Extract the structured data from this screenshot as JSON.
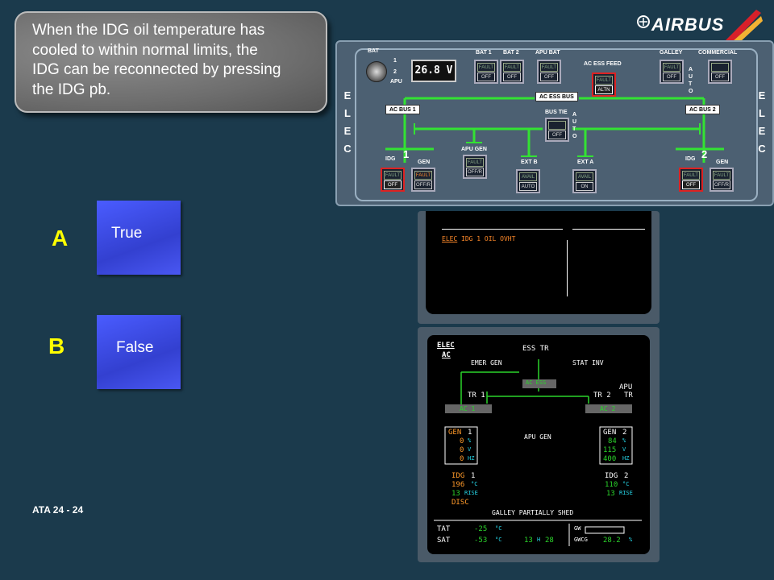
{
  "question": {
    "lines": [
      "When the IDG oil temperature has",
      "cooled to within normal limits, the",
      "IDG can be reconnected by pressing",
      "the IDG pb."
    ]
  },
  "logo": {
    "text": "AIRBUS"
  },
  "answers": [
    {
      "letter": "A",
      "label": "True"
    },
    {
      "letter": "B",
      "label": "False"
    }
  ],
  "footer": {
    "ata": "ATA 24 - 24"
  },
  "overhead": {
    "side_label": [
      "E",
      "L",
      "E",
      "C"
    ],
    "bat_label": "BAT",
    "bat_pos": [
      "1",
      "2",
      "APU"
    ],
    "bat_display": "26.8 V",
    "pbs": {
      "bat1": {
        "title": "BAT 1",
        "f": "FAULT",
        "o": "OFF"
      },
      "bat2": {
        "title": "BAT 2",
        "f": "FAULT",
        "o": "OFF"
      },
      "apubat": {
        "title": "APU BAT",
        "f": "FAULT",
        "o": "OFF"
      },
      "acess": {
        "title": "AC ESS FEED",
        "f": "FAULT",
        "o": "ALTN"
      },
      "galley": {
        "title": "GALLEY",
        "f": "FAULT",
        "o": "OFF"
      },
      "commercial": {
        "title": "COMMERCIAL",
        "f": "",
        "o": "OFF"
      },
      "bustie": {
        "title": "BUS TIE",
        "f": "",
        "o": "OFF"
      },
      "apugen": {
        "title": "APU GEN",
        "f": "FAULT",
        "o": "OFF/R"
      },
      "extb": {
        "title": "EXT B",
        "f": "AVAIL",
        "o": "AUTO"
      },
      "exta": {
        "title": "EXT A",
        "f": "AVAIL",
        "o": "ON"
      },
      "idg1": {
        "title": "IDG",
        "f": "FAULT",
        "o": "OFF"
      },
      "gen1": {
        "title": "GEN",
        "f": "FAULT",
        "o": "OFF/R"
      },
      "idg2": {
        "title": "IDG",
        "f": "FAULT",
        "o": "OFF"
      },
      "gen2": {
        "title": "GEN",
        "f": "FAULT",
        "o": "OFF/R"
      }
    },
    "auto": "AUTO",
    "buses": {
      "acess": "AC ESS BUS",
      "ac1": "AC BUS 1",
      "ac2": "AC BUS 2"
    },
    "eng_nums": [
      "1",
      "2"
    ]
  },
  "ewd": {
    "msg_title": "ELEC",
    "msg_text": "IDG 1 OIL OVHT"
  },
  "sd": {
    "title": "ELEC",
    "sub": "AC",
    "ess_tr": "ESS TR",
    "emer_gen": "EMER GEN",
    "stat_inv": "STAT INV",
    "ac_ess": "AC ESS",
    "tr1": "TR 1",
    "tr2": "TR 2",
    "apu_tr": "APU",
    "apu_tr2": "TR",
    "ac1": "AC 1",
    "ac2": "AC 2",
    "apu_gen": "APU GEN",
    "gen1": {
      "title": "GEN",
      "num": "1",
      "pct": "0",
      "v": "0",
      "hz": "0"
    },
    "gen2": {
      "title": "GEN",
      "num": "2",
      "pct": "84",
      "v": "115",
      "hz": "400"
    },
    "units": {
      "pct": "%",
      "v": "V",
      "hz": "HZ"
    },
    "idg1": {
      "title": "IDG",
      "num": "1",
      "temp": "196",
      "rise": "13",
      "disc": "DISC"
    },
    "idg2": {
      "title": "IDG",
      "num": "2",
      "temp": "110",
      "rise": "13"
    },
    "deg": "°C",
    "rise": "RISE",
    "galley": "GALLEY PARTIALLY SHED",
    "tat_l": "TAT",
    "tat": "-25",
    "sat_l": "SAT",
    "sat": "-53",
    "time_h": "13",
    "time_m": "28",
    "h": "H",
    "gw_l": "GW",
    "gwcg_l": "GWCG",
    "gwcg": "28.2",
    "pct": "%"
  },
  "colors": {
    "bg": "#1b3a4c",
    "answer": "#3f50e8",
    "letter": "#ffff00"
  }
}
